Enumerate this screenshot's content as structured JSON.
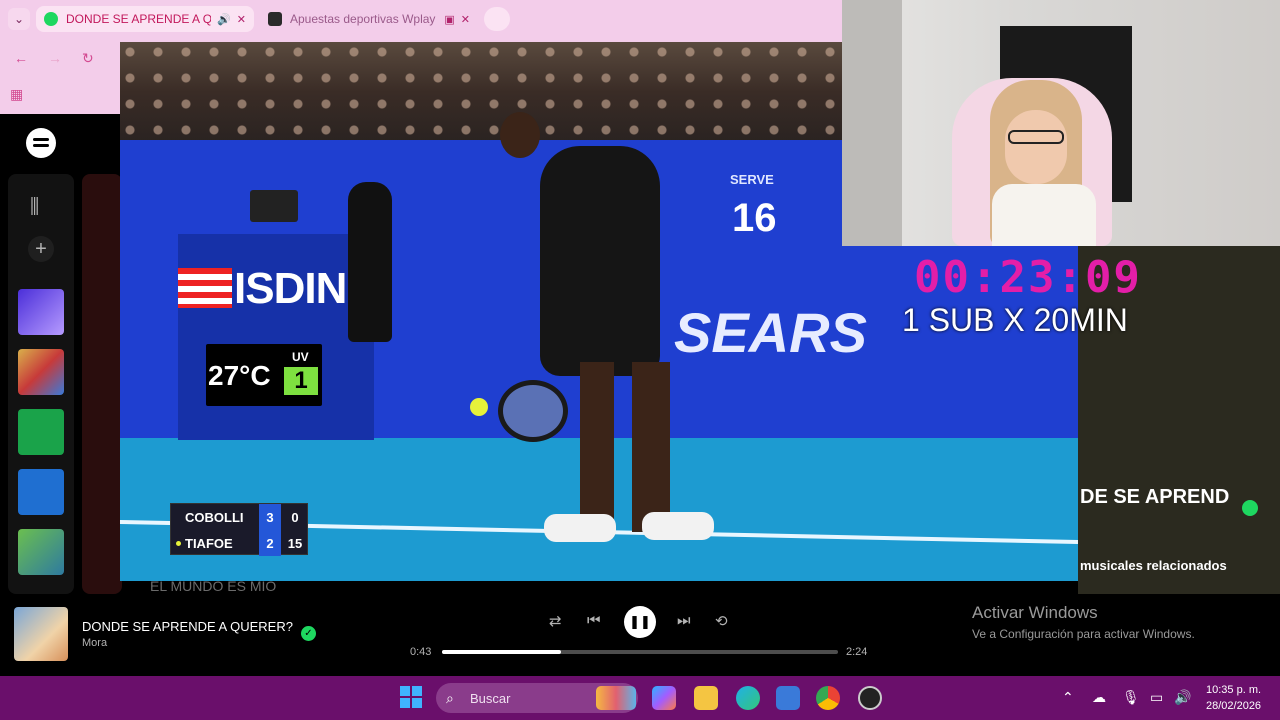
{
  "browser": {
    "tabs": [
      {
        "title": "DONDE SE APRENDE A QUE",
        "icon": "spotify-icon"
      },
      {
        "title": "Apuestas deportivas Wplay",
        "icon": "wplay-icon"
      }
    ]
  },
  "video": {
    "sponsor": "ISDIN",
    "temperature": "27°C",
    "uv_label": "UV",
    "uv_value": "1",
    "serve_label": "SERVE",
    "serve_number": "16",
    "banner": "SEARS",
    "score": {
      "players": [
        {
          "name": "COBOLLI",
          "sets": "3",
          "points": "0",
          "serving": false
        },
        {
          "name": "TIAFOE",
          "sets": "2",
          "points": "15",
          "serving": true
        }
      ]
    }
  },
  "stream": {
    "timer": "00:23:09",
    "sub_text": "1 SUB X 20MIN"
  },
  "spotify": {
    "background_text": "EL MUNDO ES MIO",
    "overlay_song": "DE SE APREND",
    "related": "musicales relacionados",
    "now_playing": {
      "title": "DONDE SE APRENDE A QUERER?",
      "artist": "Mora",
      "current_time": "0:43",
      "total_time": "2:24",
      "progress": 0.3
    }
  },
  "windows": {
    "activate_title": "Activar Windows",
    "activate_sub": "Ve a Configuración para activar Windows."
  },
  "taskbar": {
    "search_label": "Buscar",
    "clock_time": "10:35 p. m.",
    "clock_date": "28/02/2026"
  }
}
